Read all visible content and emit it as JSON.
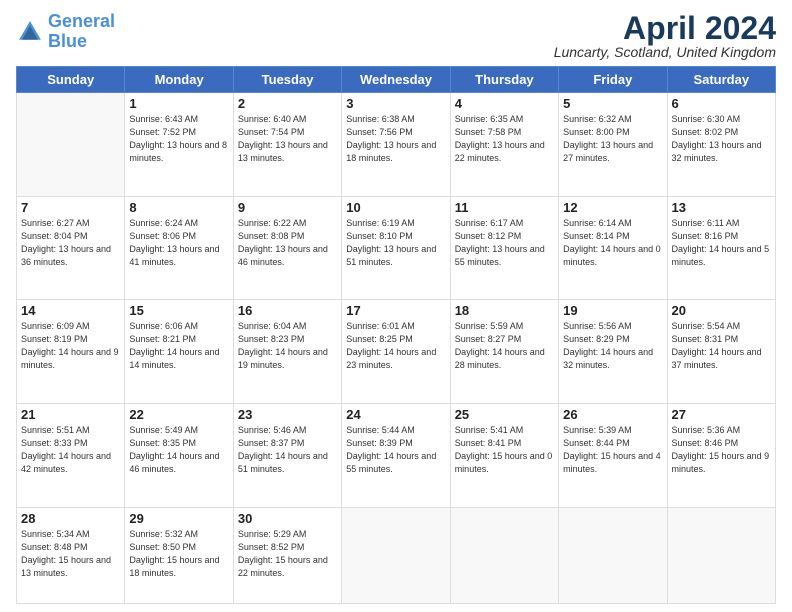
{
  "logo": {
    "text_general": "General",
    "text_blue": "Blue"
  },
  "title": "April 2024",
  "location": "Luncarty, Scotland, United Kingdom",
  "days_of_week": [
    "Sunday",
    "Monday",
    "Tuesday",
    "Wednesday",
    "Thursday",
    "Friday",
    "Saturday"
  ],
  "weeks": [
    [
      {
        "day": null
      },
      {
        "day": 1,
        "sunrise": "6:43 AM",
        "sunset": "7:52 PM",
        "daylight": "13 hours and 8 minutes."
      },
      {
        "day": 2,
        "sunrise": "6:40 AM",
        "sunset": "7:54 PM",
        "daylight": "13 hours and 13 minutes."
      },
      {
        "day": 3,
        "sunrise": "6:38 AM",
        "sunset": "7:56 PM",
        "daylight": "13 hours and 18 minutes."
      },
      {
        "day": 4,
        "sunrise": "6:35 AM",
        "sunset": "7:58 PM",
        "daylight": "13 hours and 22 minutes."
      },
      {
        "day": 5,
        "sunrise": "6:32 AM",
        "sunset": "8:00 PM",
        "daylight": "13 hours and 27 minutes."
      },
      {
        "day": 6,
        "sunrise": "6:30 AM",
        "sunset": "8:02 PM",
        "daylight": "13 hours and 32 minutes."
      }
    ],
    [
      {
        "day": 7,
        "sunrise": "6:27 AM",
        "sunset": "8:04 PM",
        "daylight": "13 hours and 36 minutes."
      },
      {
        "day": 8,
        "sunrise": "6:24 AM",
        "sunset": "8:06 PM",
        "daylight": "13 hours and 41 minutes."
      },
      {
        "day": 9,
        "sunrise": "6:22 AM",
        "sunset": "8:08 PM",
        "daylight": "13 hours and 46 minutes."
      },
      {
        "day": 10,
        "sunrise": "6:19 AM",
        "sunset": "8:10 PM",
        "daylight": "13 hours and 51 minutes."
      },
      {
        "day": 11,
        "sunrise": "6:17 AM",
        "sunset": "8:12 PM",
        "daylight": "13 hours and 55 minutes."
      },
      {
        "day": 12,
        "sunrise": "6:14 AM",
        "sunset": "8:14 PM",
        "daylight": "14 hours and 0 minutes."
      },
      {
        "day": 13,
        "sunrise": "6:11 AM",
        "sunset": "8:16 PM",
        "daylight": "14 hours and 5 minutes."
      }
    ],
    [
      {
        "day": 14,
        "sunrise": "6:09 AM",
        "sunset": "8:19 PM",
        "daylight": "14 hours and 9 minutes."
      },
      {
        "day": 15,
        "sunrise": "6:06 AM",
        "sunset": "8:21 PM",
        "daylight": "14 hours and 14 minutes."
      },
      {
        "day": 16,
        "sunrise": "6:04 AM",
        "sunset": "8:23 PM",
        "daylight": "14 hours and 19 minutes."
      },
      {
        "day": 17,
        "sunrise": "6:01 AM",
        "sunset": "8:25 PM",
        "daylight": "14 hours and 23 minutes."
      },
      {
        "day": 18,
        "sunrise": "5:59 AM",
        "sunset": "8:27 PM",
        "daylight": "14 hours and 28 minutes."
      },
      {
        "day": 19,
        "sunrise": "5:56 AM",
        "sunset": "8:29 PM",
        "daylight": "14 hours and 32 minutes."
      },
      {
        "day": 20,
        "sunrise": "5:54 AM",
        "sunset": "8:31 PM",
        "daylight": "14 hours and 37 minutes."
      }
    ],
    [
      {
        "day": 21,
        "sunrise": "5:51 AM",
        "sunset": "8:33 PM",
        "daylight": "14 hours and 42 minutes."
      },
      {
        "day": 22,
        "sunrise": "5:49 AM",
        "sunset": "8:35 PM",
        "daylight": "14 hours and 46 minutes."
      },
      {
        "day": 23,
        "sunrise": "5:46 AM",
        "sunset": "8:37 PM",
        "daylight": "14 hours and 51 minutes."
      },
      {
        "day": 24,
        "sunrise": "5:44 AM",
        "sunset": "8:39 PM",
        "daylight": "14 hours and 55 minutes."
      },
      {
        "day": 25,
        "sunrise": "5:41 AM",
        "sunset": "8:41 PM",
        "daylight": "15 hours and 0 minutes."
      },
      {
        "day": 26,
        "sunrise": "5:39 AM",
        "sunset": "8:44 PM",
        "daylight": "15 hours and 4 minutes."
      },
      {
        "day": 27,
        "sunrise": "5:36 AM",
        "sunset": "8:46 PM",
        "daylight": "15 hours and 9 minutes."
      }
    ],
    [
      {
        "day": 28,
        "sunrise": "5:34 AM",
        "sunset": "8:48 PM",
        "daylight": "15 hours and 13 minutes."
      },
      {
        "day": 29,
        "sunrise": "5:32 AM",
        "sunset": "8:50 PM",
        "daylight": "15 hours and 18 minutes."
      },
      {
        "day": 30,
        "sunrise": "5:29 AM",
        "sunset": "8:52 PM",
        "daylight": "15 hours and 22 minutes."
      },
      {
        "day": null
      },
      {
        "day": null
      },
      {
        "day": null
      },
      {
        "day": null
      }
    ]
  ]
}
